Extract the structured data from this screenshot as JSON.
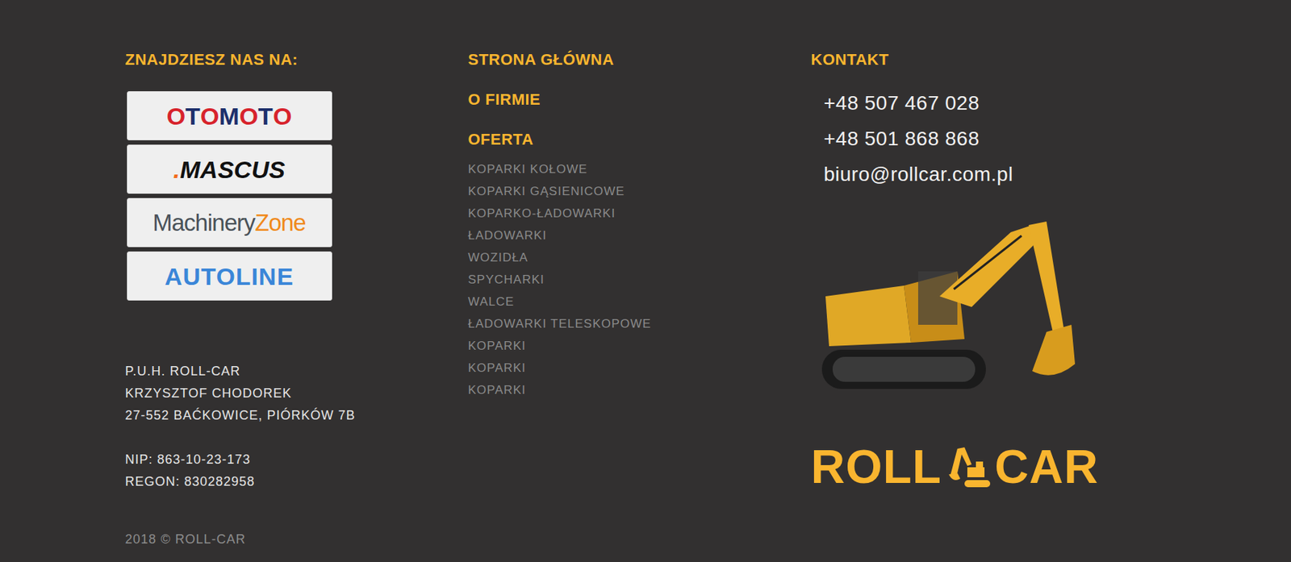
{
  "find_us": {
    "heading": "ZNAJDZIESZ NAS NA:",
    "portals": [
      {
        "kind": "bold",
        "parts": [
          {
            "text": "O",
            "color": "#d7232c"
          },
          {
            "text": "T",
            "color": "#1d2f6b"
          },
          {
            "text": "O",
            "color": "#d7232c"
          },
          {
            "text": "M",
            "color": "#1d2f6b"
          },
          {
            "text": "O",
            "color": "#d7232c"
          },
          {
            "text": "T",
            "color": "#1d2f6b"
          },
          {
            "text": "O",
            "color": "#d7232c"
          }
        ]
      },
      {
        "kind": "italic",
        "parts": [
          {
            "text": ".",
            "color": "#f26c1d"
          },
          {
            "text": "MASCUS",
            "color": "#111111"
          }
        ]
      },
      {
        "kind": "plain",
        "parts": [
          {
            "text": "Machinery",
            "color": "#4a5259"
          },
          {
            "text": "Zone",
            "color": "#f08a1c"
          }
        ]
      },
      {
        "kind": "outline",
        "parts": [
          {
            "text": "AUTOLINE",
            "color": "#3a86d8"
          }
        ]
      }
    ]
  },
  "company": {
    "lines": [
      "P.U.H. ROLL-CAR",
      "KRZYSZTOF CHODOREK",
      "27-552 BAĆKOWICE, PIÓRKÓW 7B"
    ],
    "ids": [
      "NIP: 863-10-23-173",
      "REGON: 830282958"
    ]
  },
  "copyright": "2018 © ROLL-CAR",
  "menu": {
    "items": [
      "STRONA GŁÓWNA",
      "O FIRMIE",
      "OFERTA"
    ],
    "offer": [
      "KOPARKI KOŁOWE",
      "KOPARKI GĄSIENICOWE",
      "KOPARKO-ŁADOWARKI",
      "ŁADOWARKI",
      "WOZIDŁA",
      "SPYCHARKI",
      "WALCE",
      "ŁADOWARKI TELESKOPOWE",
      "KOPARKI",
      "KOPARKI",
      "KOPARKI"
    ]
  },
  "contact": {
    "heading": "KONTAKT",
    "phones": [
      "+48 507 467 028",
      "+48 501 868 868"
    ],
    "email": "biuro@rollcar.com.pl"
  },
  "logo": {
    "left": "ROLL",
    "right": "CAR"
  }
}
